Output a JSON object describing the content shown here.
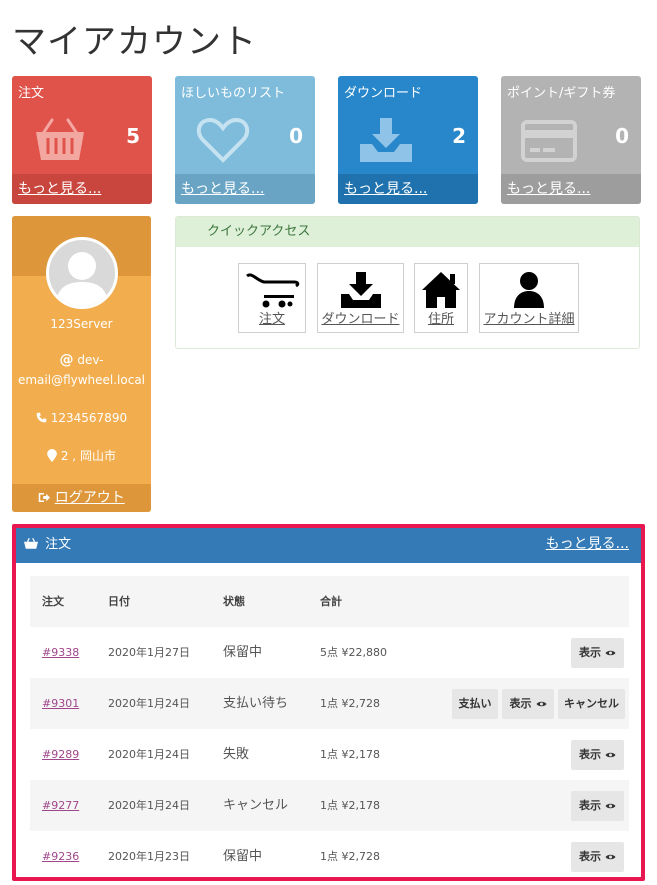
{
  "page": {
    "title": "マイアカウント"
  },
  "cards": [
    {
      "title": "注文",
      "count": "5",
      "more": "もっと見る...",
      "color": "#e0534a",
      "foot_color": "#c8463e",
      "icon": "basket-icon"
    },
    {
      "title": "ほしいものリスト",
      "count": "0",
      "more": "もっと見る...",
      "color": "#7fbcdc",
      "foot_color": "#6aa4c4",
      "icon": "heart-icon"
    },
    {
      "title": "ダウンロード",
      "count": "2",
      "more": "もっと見る...",
      "color": "#2787ca",
      "foot_color": "#1f72ad",
      "icon": "download-icon"
    },
    {
      "title": "ポイント/ギフト券",
      "count": "0",
      "more": "もっと見る...",
      "color": "#b3b3b3",
      "foot_color": "#9d9d9d",
      "icon": "card-icon"
    }
  ],
  "profile": {
    "name": "123Server",
    "email_line1": "dev-",
    "email_line2": "email@flywheel.local",
    "phone": "1234567890",
    "address": "2 , 岡山市",
    "logout": "ログアウト",
    "colors": {
      "body": "#f2ad4e",
      "band": "#dd973a"
    }
  },
  "quick_access": {
    "title": "クイックアクセス",
    "items": [
      {
        "label": "注文",
        "icon": "cart-icon"
      },
      {
        "label": "ダウンロード",
        "icon": "download-tray-icon"
      },
      {
        "label": "住所",
        "icon": "home-icon"
      },
      {
        "label": "アカウント詳細",
        "icon": "user-icon"
      }
    ]
  },
  "orders": {
    "title": "注文",
    "more": "もっと見る...",
    "columns": [
      "注文",
      "日付",
      "状態",
      "合計"
    ],
    "rows": [
      {
        "number": "#9338",
        "date": "2020年1月27日",
        "status": "保留中",
        "total": "5点 ¥22,880",
        "actions": [
          "表示"
        ]
      },
      {
        "number": "#9301",
        "date": "2020年1月24日",
        "status": "支払い待ち",
        "total": "1点 ¥2,728",
        "actions": [
          "支払い",
          "表示",
          "キャンセル"
        ]
      },
      {
        "number": "#9289",
        "date": "2020年1月24日",
        "status": "失敗",
        "total": "1点 ¥2,178",
        "actions": [
          "表示"
        ]
      },
      {
        "number": "#9277",
        "date": "2020年1月24日",
        "status": "キャンセル",
        "total": "1点 ¥2,178",
        "actions": [
          "表示"
        ]
      },
      {
        "number": "#9236",
        "date": "2020年1月23日",
        "status": "保留中",
        "total": "1点 ¥2,728",
        "actions": [
          "表示"
        ]
      }
    ],
    "colors": {
      "header": "#337ab7",
      "highlight_border": "#e8174f"
    }
  }
}
